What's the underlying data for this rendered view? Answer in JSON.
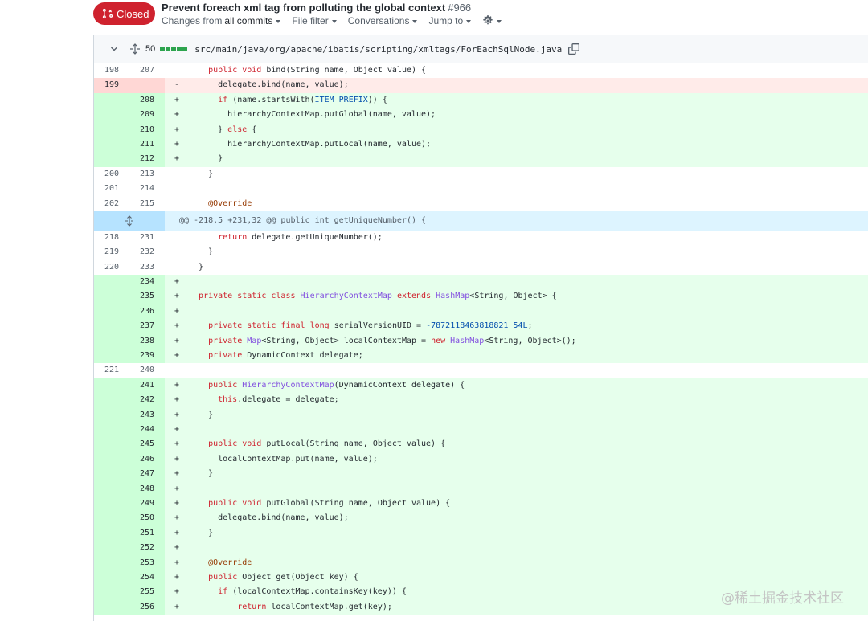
{
  "pr": {
    "state_label": "Closed",
    "state_color": "#cf222e",
    "title": "Prevent foreach xml tag from polluting the global context",
    "number": "#966",
    "nav": {
      "changes_prefix": "Changes from",
      "changes_value": "all commits",
      "file_filter": "File filter",
      "conversations": "Conversations",
      "jump_to": "Jump to"
    }
  },
  "file": {
    "changes_count": "50",
    "path": "src/main/java/org/apache/ibatis/scripting/xmltags/ForEachSqlNode.java"
  },
  "hunk_header": "@@ -218,5 +231,32 @@ public int getUniqueNumber() {",
  "lines_top": [
    {
      "a": "198",
      "b": "207",
      "m": "",
      "code": "    public void bind(String name, Object value) {"
    },
    {
      "a": "199",
      "b": "",
      "m": "-",
      "code": "      delegate.bind(name, value);"
    },
    {
      "a": "",
      "b": "208",
      "m": "+",
      "code": "      if (name.startsWith(ITEM_PREFIX)) {"
    },
    {
      "a": "",
      "b": "209",
      "m": "+",
      "code": "        hierarchyContextMap.putGlobal(name, value);"
    },
    {
      "a": "",
      "b": "210",
      "m": "+",
      "code": "      } else {"
    },
    {
      "a": "",
      "b": "211",
      "m": "+",
      "code": "        hierarchyContextMap.putLocal(name, value);"
    },
    {
      "a": "",
      "b": "212",
      "m": "+",
      "code": "      }"
    },
    {
      "a": "200",
      "b": "213",
      "m": "",
      "code": "    }"
    },
    {
      "a": "201",
      "b": "214",
      "m": "",
      "code": ""
    },
    {
      "a": "202",
      "b": "215",
      "m": "",
      "code": "    @Override"
    }
  ],
  "lines_bottom": [
    {
      "a": "218",
      "b": "231",
      "m": "",
      "code": "      return delegate.getUniqueNumber();"
    },
    {
      "a": "219",
      "b": "232",
      "m": "",
      "code": "    }"
    },
    {
      "a": "220",
      "b": "233",
      "m": "",
      "code": "  }"
    },
    {
      "a": "",
      "b": "234",
      "m": "+",
      "code": ""
    },
    {
      "a": "",
      "b": "235",
      "m": "+",
      "code": "  private static class HierarchyContextMap extends HashMap<String, Object> {"
    },
    {
      "a": "",
      "b": "236",
      "m": "+",
      "code": ""
    },
    {
      "a": "",
      "b": "237",
      "m": "+",
      "code": "    private static final long serialVersionUID = -7872118463818821 54L;"
    },
    {
      "a": "",
      "b": "238",
      "m": "+",
      "code": "    private Map<String, Object> localContextMap = new HashMap<String, Object>();"
    },
    {
      "a": "",
      "b": "239",
      "m": "+",
      "code": "    private DynamicContext delegate;"
    },
    {
      "a": "221",
      "b": "240",
      "m": "",
      "code": ""
    },
    {
      "a": "",
      "b": "241",
      "m": "+",
      "code": "    public HierarchyContextMap(DynamicContext delegate) {"
    },
    {
      "a": "",
      "b": "242",
      "m": "+",
      "code": "      this.delegate = delegate;"
    },
    {
      "a": "",
      "b": "243",
      "m": "+",
      "code": "    }"
    },
    {
      "a": "",
      "b": "244",
      "m": "+",
      "code": ""
    },
    {
      "a": "",
      "b": "245",
      "m": "+",
      "code": "    public void putLocal(String name, Object value) {"
    },
    {
      "a": "",
      "b": "246",
      "m": "+",
      "code": "      localContextMap.put(name, value);"
    },
    {
      "a": "",
      "b": "247",
      "m": "+",
      "code": "    }"
    },
    {
      "a": "",
      "b": "248",
      "m": "+",
      "code": ""
    },
    {
      "a": "",
      "b": "249",
      "m": "+",
      "code": "    public void putGlobal(String name, Object value) {"
    },
    {
      "a": "",
      "b": "250",
      "m": "+",
      "code": "      delegate.bind(name, value);"
    },
    {
      "a": "",
      "b": "251",
      "m": "+",
      "code": "    }"
    },
    {
      "a": "",
      "b": "252",
      "m": "+",
      "code": ""
    },
    {
      "a": "",
      "b": "253",
      "m": "+",
      "code": "    @Override"
    },
    {
      "a": "",
      "b": "254",
      "m": "+",
      "code": "    public Object get(Object key) {"
    },
    {
      "a": "",
      "b": "255",
      "m": "+",
      "code": "      if (localContextMap.containsKey(key)) {"
    },
    {
      "a": "",
      "b": "256",
      "m": "+",
      "code": "          return localContextMap.get(key);"
    }
  ],
  "watermark": "@稀土掘金技术社区"
}
